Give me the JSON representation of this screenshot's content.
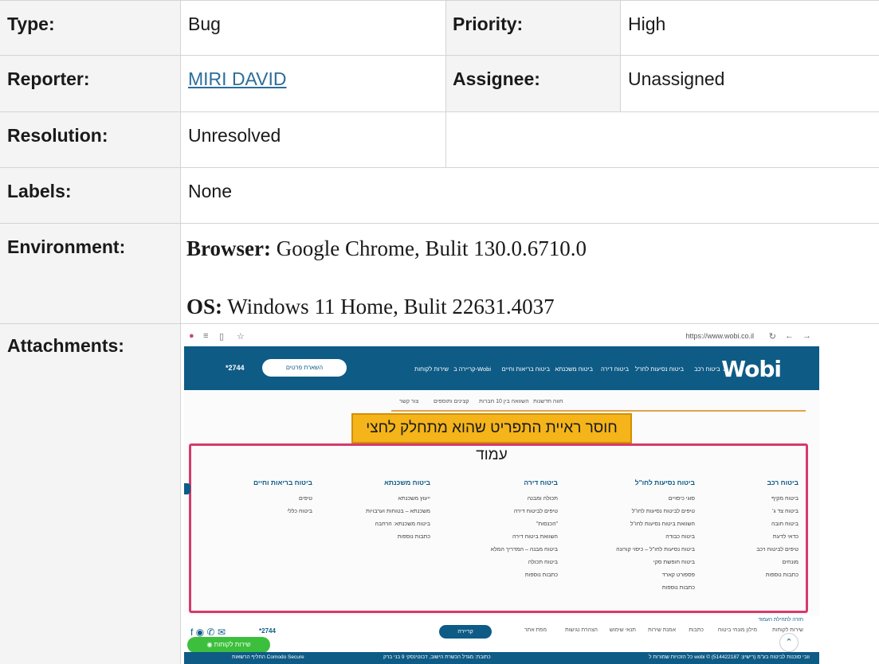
{
  "details": {
    "type_label": "Type:",
    "type_value": "Bug",
    "priority_label": "Priority:",
    "priority_value": "High",
    "reporter_label": "Reporter:",
    "reporter_value": "MIRI DAVID",
    "assignee_label": "Assignee:",
    "assignee_value": "Unassigned",
    "resolution_label": "Resolution:",
    "resolution_value": "Unresolved",
    "labels_label": "Labels:",
    "labels_value": "None",
    "environment_label": "Environment:",
    "env_browser_key": "Browser:",
    "env_browser_value": " Google Chrome, Bulit 130.0.6710.0",
    "env_os_key": "OS:",
    "env_os_value": " Windows 11 Home, Bulit 22631.4037",
    "attachments_label": "Attachments:"
  },
  "attachment": {
    "browser": {
      "url": "https://www.wobi.co.il"
    },
    "header": {
      "logo": "Wobi",
      "nav": [
        "ביטוח רכב ⌄",
        "ביטוח נסיעות לחו\"ל",
        "ביטוח דירה",
        "ביטוח משכנתא",
        "ביטוח בריאות וחיים",
        "קריירה ב-Wobi",
        "שירות לקוחות"
      ],
      "cta": "השארת פרטים",
      "phone": "*2744"
    },
    "subnav": [
      "חווה חדשנות",
      "השוואה בין 10 חברות",
      "קצינים ותוספים",
      "צור קשר"
    ],
    "banner": "חוסר ראיית התפריט שהוא מתחלק לחצי עמוד",
    "columns": [
      {
        "heading": "ביטוח רכב",
        "items": [
          "ביטוח מקיף",
          "ביטוח צד ג'",
          "ביטוח חובה",
          "כדאי לדעת",
          "טיפים לביטוח רכב",
          "מונחים",
          "כתבות נוספות"
        ]
      },
      {
        "heading": "ביטוח נסיעות לחו\"ל",
        "items": [
          "סוגי כיסויים",
          "טיפים לביטוח נסיעות לחו\"ל",
          "השוואת ביטוח נסיעות לחו\"ל",
          "ביטוח כבודה",
          "ביטוח נסיעות לחו\"ל – כיסוי קורונה",
          "ביטוח חופשת סקי",
          "פספורט קארד",
          "כתבות נוספות"
        ]
      },
      {
        "heading": "ביטוח דירה",
        "items": [
          "תכולה ומבנה",
          "טיפים לביטוח דירה",
          "\"הכנסות\"",
          "השוואת ביטוח דירה",
          "ביטוח מבנה – המדריך המלא",
          "ביטוח תכולה",
          "כתבות נוספות"
        ]
      },
      {
        "heading": "ביטוח משכנתא",
        "items": [
          "ייעוץ משכנתא",
          "משכנתא – בטוחות וערבויות",
          "ביטוח משכנתא: הרחבה",
          "כתבות נוספות"
        ]
      },
      {
        "heading": "ביטוח בריאות וחיים",
        "items": [
          "טיפים",
          "ביטוח כללי"
        ]
      }
    ],
    "footer": {
      "back_to_top": "חזרה לתחילת העמוד",
      "links": [
        "שירות לקוחות",
        "מילון מונחי ביטוח",
        "כתבות",
        "אמנת שירות",
        "תנאי שימוש",
        "הצהרת נגישות",
        "מפת אתר"
      ],
      "career_button": "קריירה",
      "phone": "*2744",
      "whatsapp": "שירות לקוחות",
      "bottom_left": "החליף הרשאות Comodo Secure",
      "bottom_mid": "כתובת: מגדל הכשרת הישוב, דבוטינסקי 9 בני ברק",
      "bottom_right": "כל הזכויות שמורות ל wobi © וובי סוכנות לביטוח בע\"מ (רישיון: 514422187)"
    }
  }
}
